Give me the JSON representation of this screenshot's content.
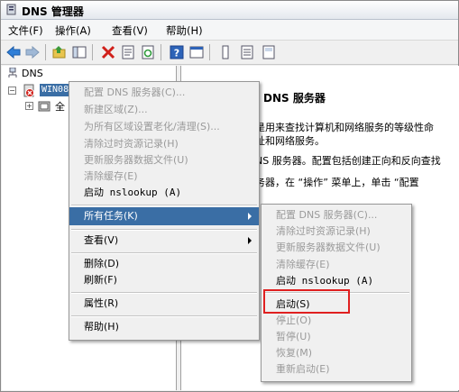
{
  "window": {
    "title": "DNS 管理器"
  },
  "menubar": {
    "items": [
      "文件(F)",
      "操作(A)",
      "查看(V)",
      "帮助(H)"
    ]
  },
  "toolbar": {
    "icons": [
      "back-arrow-icon",
      "forward-arrow-icon",
      "up-folder-icon",
      "console-tree-icon",
      "delete-icon",
      "properties-icon",
      "refresh-icon",
      "help-icon",
      "console-icon",
      "list-icon",
      "details-icon",
      "tile-icon"
    ]
  },
  "tree": {
    "root": "DNS",
    "server": "WIN08",
    "child": "全"
  },
  "right": {
    "heading": "DNS 服务器",
    "line1": "是用来查找计算机和网络服务的等级性命",
    "line2": "址和网络服务。",
    "line3": "NS 服务器。配置包括创建正向和反向查找",
    "line4": "务器，在 “操作” 菜单上，单击 “配置"
  },
  "context_menu": {
    "items": [
      {
        "label": "配置 DNS 服务器(C)...",
        "disabled": true
      },
      {
        "label": "新建区域(Z)...",
        "disabled": true
      },
      {
        "label": "为所有区域设置老化/清理(S)...",
        "disabled": true
      },
      {
        "label": "清除过时资源记录(H)",
        "disabled": true
      },
      {
        "label": "更新服务器数据文件(U)",
        "disabled": true
      },
      {
        "label": "清除缓存(E)",
        "disabled": true
      },
      {
        "label": "启动 nslookup (A)",
        "disabled": false
      },
      {
        "label": "所有任务(K)",
        "disabled": false,
        "highlighted": true,
        "submenu": true
      },
      {
        "label": "查看(V)",
        "disabled": false,
        "submenu": true
      },
      {
        "label": "删除(D)",
        "disabled": false
      },
      {
        "label": "刷新(F)",
        "disabled": false
      },
      {
        "label": "属性(R)",
        "disabled": false
      },
      {
        "label": "帮助(H)",
        "disabled": false
      }
    ]
  },
  "submenu": {
    "items": [
      {
        "label": "配置 DNS 服务器(C)...",
        "disabled": true
      },
      {
        "label": "清除过时资源记录(H)",
        "disabled": true
      },
      {
        "label": "更新服务器数据文件(U)",
        "disabled": true
      },
      {
        "label": "清除缓存(E)",
        "disabled": true
      },
      {
        "label": "启动 nslookup (A)",
        "disabled": false
      },
      {
        "label": "启动(S)",
        "disabled": false,
        "highlighted_box": true
      },
      {
        "label": "停止(O)",
        "disabled": true
      },
      {
        "label": "暂停(U)",
        "disabled": true
      },
      {
        "label": "恢复(M)",
        "disabled": true
      },
      {
        "label": "重新启动(E)",
        "disabled": true
      }
    ]
  },
  "colors": {
    "selection": "#3a6ea5",
    "highlight_box": "#e02020",
    "disabled_text": "#9a9a9a"
  }
}
